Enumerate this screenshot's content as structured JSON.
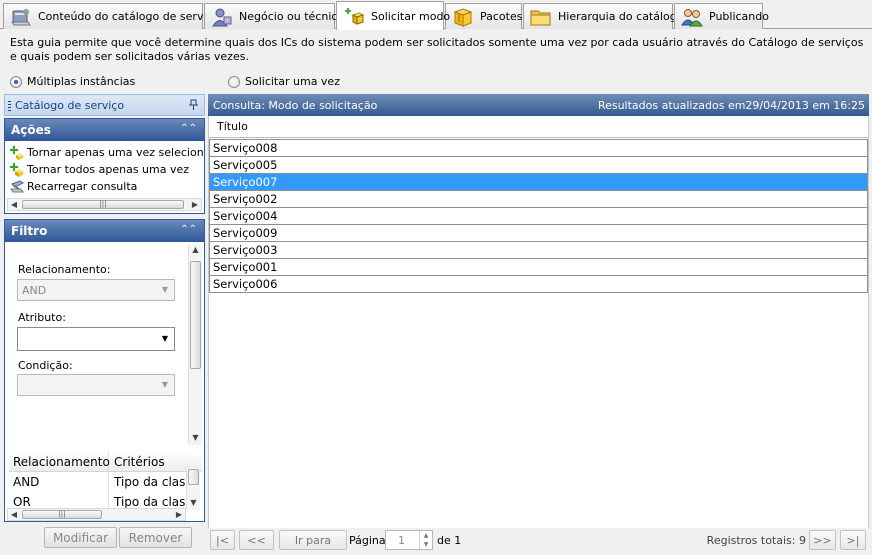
{
  "tabs": [
    {
      "label": "Conteúdo do catálogo de serviço",
      "icon": "catalog-content-icon",
      "active": false
    },
    {
      "label": "Negócio ou técnico",
      "icon": "business-user-icon",
      "active": false
    },
    {
      "label": "Solicitar modo",
      "icon": "request-mode-icon",
      "active": true
    },
    {
      "label": "Pacotes",
      "icon": "package-icon",
      "active": false
    },
    {
      "label": "Hierarquia do catálogo",
      "icon": "folder-icon",
      "active": false
    },
    {
      "label": "Publicando",
      "icon": "users-icon",
      "active": false
    }
  ],
  "description": "Esta guia permite que você determine quais dos ICs do sistema podem ser solicitados somente uma vez por cada usuário através do Catálogo de serviços e quais podem ser solicitados várias vezes.",
  "mode": {
    "multiple_label": "Múltiplas instâncias",
    "once_label": "Solicitar uma vez",
    "selected": "multiple"
  },
  "left_panel": {
    "title": "Catálogo de serviço",
    "actions": {
      "title": "Ações",
      "items": [
        "Tornar apenas uma vez selecionado",
        "Tornar todos apenas uma vez",
        "Recarregar consulta"
      ]
    },
    "filter": {
      "title": "Filtro",
      "relationship_label": "Relacionamento:",
      "relationship_value": "AND",
      "attribute_label": "Atributo:",
      "attribute_value": "",
      "condition_label": "Condição:",
      "condition_value": "",
      "table_headers": [
        "Relacionamento",
        "Critérios"
      ],
      "table_rows": [
        [
          "AND",
          "Tipo da classe"
        ],
        [
          "OR",
          "Tipo da classe"
        ]
      ],
      "modify_label": "Modificar",
      "remove_label": "Remover"
    }
  },
  "grid": {
    "query_label": "Consulta: Modo de solicitação",
    "updated_label": "Resultados atualizados em29/04/2013 em 16:25",
    "column_header": "Título",
    "rows": [
      "Serviço008",
      "Serviço005",
      "Serviço007",
      "Serviço002",
      "Serviço004",
      "Serviço009",
      "Serviço003",
      "Serviço001",
      "Serviço006"
    ],
    "selected_row": "Serviço007"
  },
  "pager": {
    "first_label": "|<",
    "prev_label": "<<",
    "goto_label": "Ir para",
    "page_label": "Página",
    "page_value": "1",
    "of_label": "de 1",
    "total_label": "Registros totais: 9",
    "next_label": ">>",
    "last_label": ">|"
  },
  "colors": {
    "selection": "#3399ff",
    "panel_header": "#2f5797",
    "grid_header": "#34598f"
  }
}
